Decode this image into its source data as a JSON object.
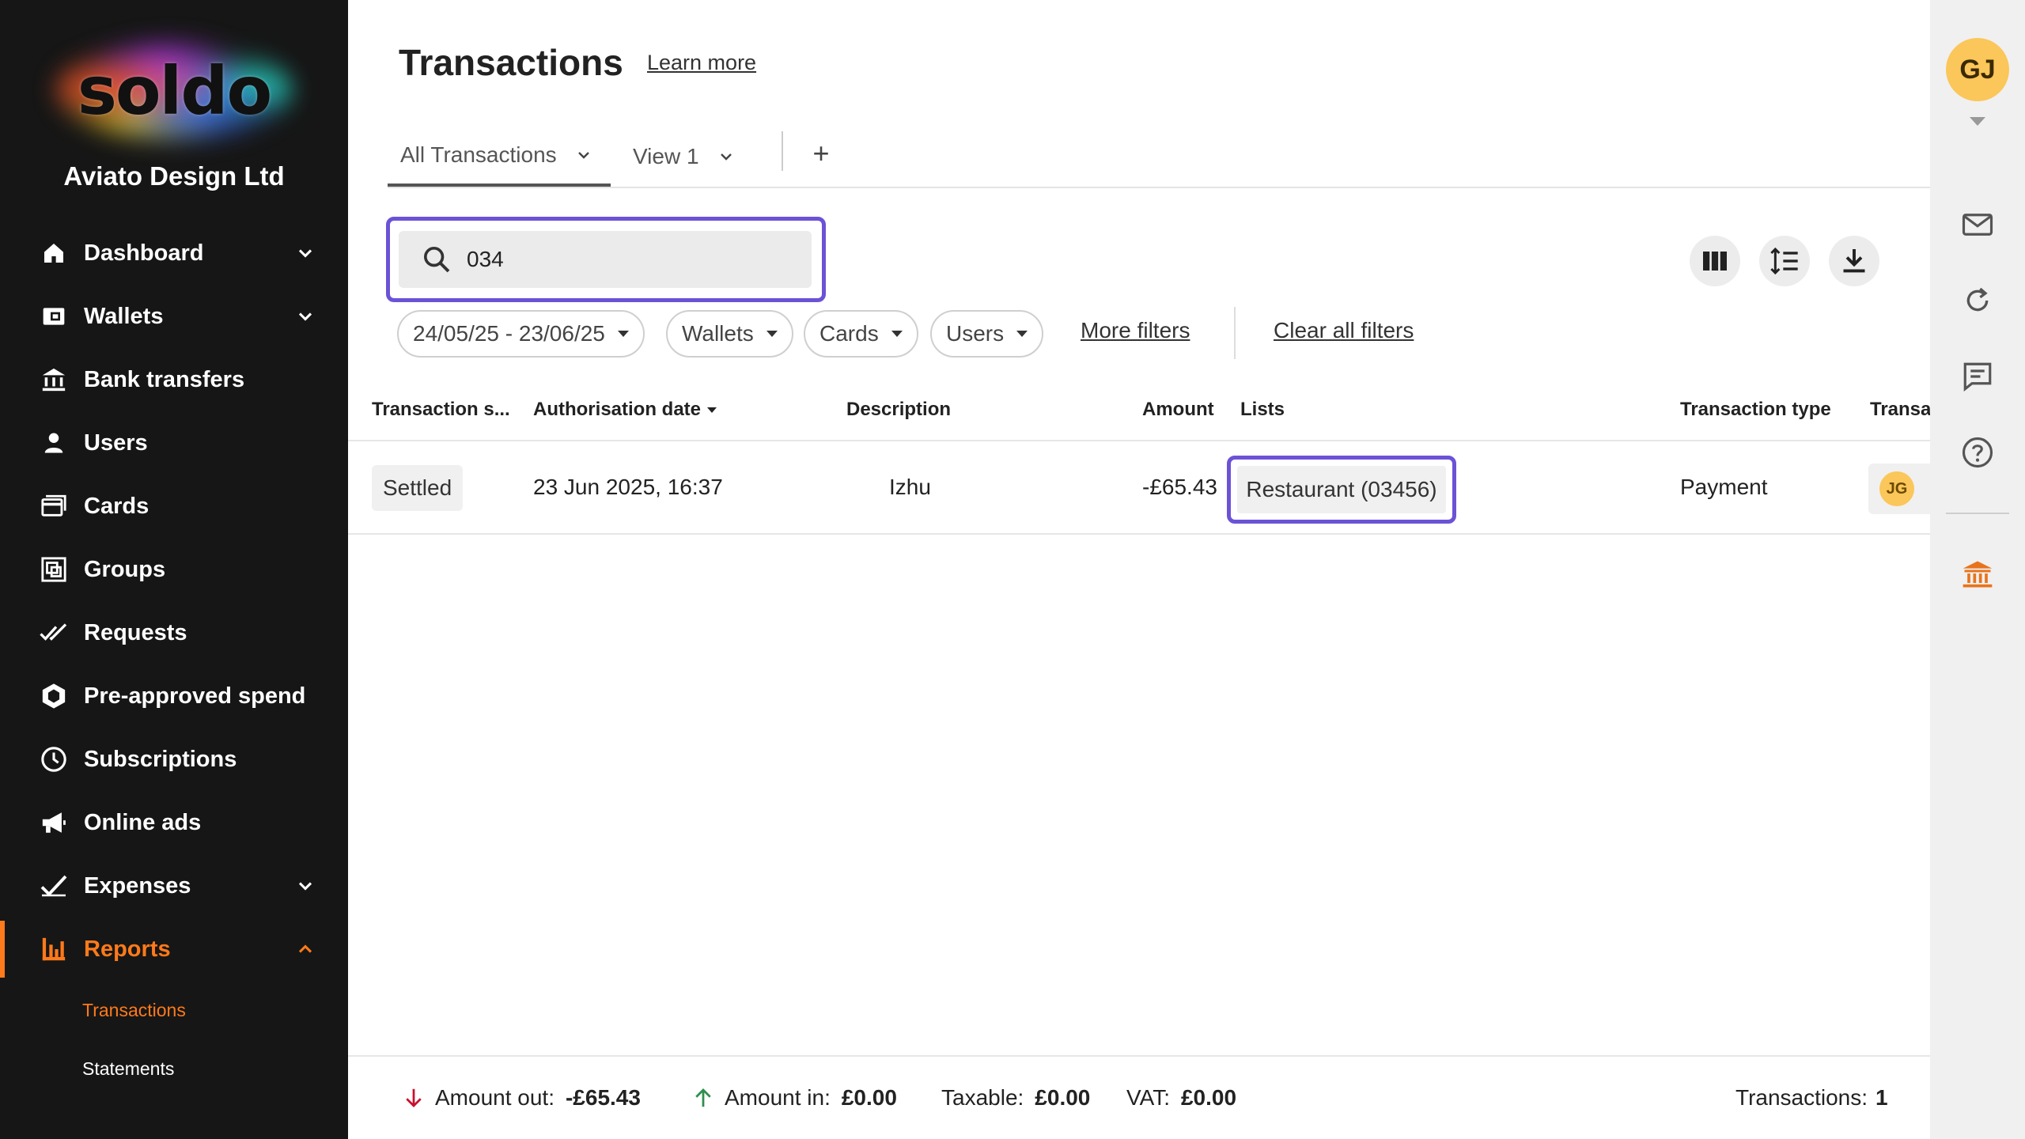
{
  "brand": {
    "logo_text": "soldo",
    "company": "Aviato Design Ltd",
    "accent": "#ff7a1a",
    "highlight": "#6c52d6"
  },
  "sidebar": {
    "items": [
      {
        "label": "Dashboard",
        "icon": "home-icon",
        "expandable": true
      },
      {
        "label": "Wallets",
        "icon": "wallet-icon",
        "expandable": true
      },
      {
        "label": "Bank transfers",
        "icon": "bank-transfer-icon"
      },
      {
        "label": "Users",
        "icon": "user-icon"
      },
      {
        "label": "Cards",
        "icon": "cards-icon"
      },
      {
        "label": "Groups",
        "icon": "groups-icon"
      },
      {
        "label": "Requests",
        "icon": "double-check-icon"
      },
      {
        "label": "Pre-approved spend",
        "icon": "hexagon-icon"
      },
      {
        "label": "Subscriptions",
        "icon": "clock-icon"
      },
      {
        "label": "Online ads",
        "icon": "megaphone-icon"
      },
      {
        "label": "Expenses",
        "icon": "check-icon",
        "expandable": true
      },
      {
        "label": "Reports",
        "icon": "bar-chart-icon",
        "expandable": true,
        "active": true
      }
    ],
    "sub_items": [
      {
        "label": "Transactions",
        "active": true
      },
      {
        "label": "Statements"
      }
    ]
  },
  "header": {
    "title": "Transactions",
    "learn_more": "Learn more"
  },
  "tabs": {
    "items": [
      "All Transactions",
      "View 1"
    ],
    "add": "+"
  },
  "search": {
    "value": "034",
    "placeholder": ""
  },
  "filters": {
    "date_range": "24/05/25 - 23/06/25",
    "wallets": "Wallets",
    "cards": "Cards",
    "users": "Users",
    "more": "More filters",
    "clear": "Clear all filters"
  },
  "table": {
    "columns": [
      "Transaction s...",
      "Authorisation date",
      "Description",
      "Amount",
      "Lists",
      "Transaction type",
      "Transa"
    ],
    "sorted_column": "Authorisation date",
    "rows": [
      {
        "status": "Settled",
        "date": "23 Jun 2025, 16:37",
        "description": "Izhu",
        "amount": "-£65.43",
        "list": "Restaurant (03456)",
        "type": "Payment",
        "owner_initials": "JG"
      }
    ]
  },
  "footer": {
    "amount_out_label": "Amount out:",
    "amount_out": "-£65.43",
    "amount_in_label": "Amount in:",
    "amount_in": "£0.00",
    "taxable_label": "Taxable:",
    "taxable": "£0.00",
    "vat_label": "VAT:",
    "vat": "£0.00",
    "count_label": "Transactions:",
    "count": "1"
  },
  "rail": {
    "avatar": "GJ",
    "icons": [
      "mail-icon",
      "refresh-icon",
      "chat-icon",
      "help-icon",
      "bank-icon"
    ]
  }
}
